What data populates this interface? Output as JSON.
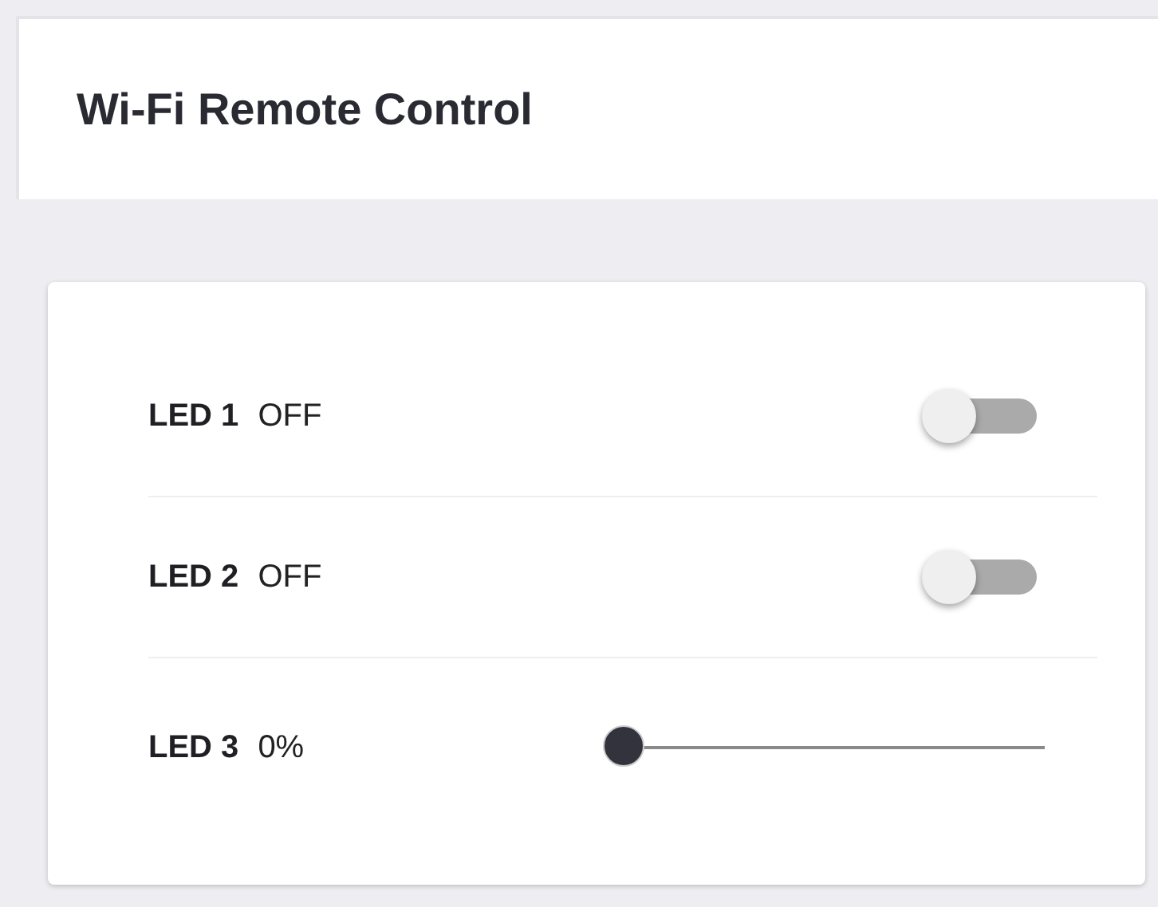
{
  "header": {
    "title": "Wi-Fi Remote Control"
  },
  "controls": [
    {
      "kind": "toggle",
      "label": "LED 1",
      "value": "OFF",
      "on": false
    },
    {
      "kind": "toggle",
      "label": "LED 2",
      "value": "OFF",
      "on": false
    },
    {
      "kind": "slider",
      "label": "LED 3",
      "value": "0%",
      "level": 0
    }
  ]
}
